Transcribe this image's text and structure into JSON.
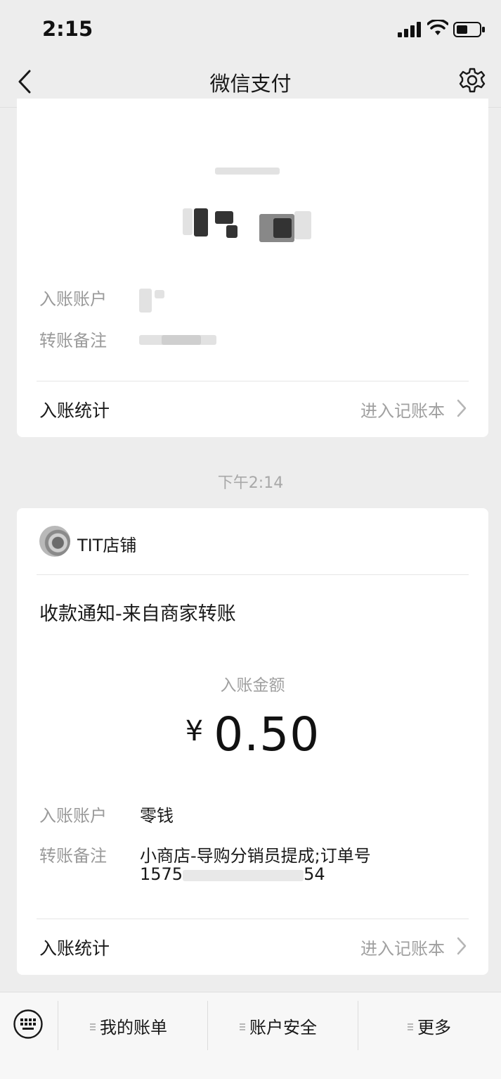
{
  "status_bar": {
    "time": "2:15",
    "icons": [
      "signal-icon",
      "wifi-icon",
      "battery-icon"
    ]
  },
  "nav": {
    "title": "微信支付",
    "back_icon": "chevron-left-icon",
    "settings_icon": "gear-icon"
  },
  "card1": {
    "account_label": "入账账户",
    "memo_label": "转账备注",
    "stats_label": "入账统计",
    "stats_link": "进入记账本"
  },
  "timestamp": "下午2:14",
  "card2": {
    "shop_name": "TIT店铺",
    "notice_title": "收款通知-来自商家转账",
    "amount_label": "入账金额",
    "currency": "¥",
    "amount": "0.50",
    "account_label": "入账账户",
    "account_value": "零钱",
    "memo_label": "转账备注",
    "memo_line1": "小商店-导购分销员提成;订单号",
    "memo_line2_start": "1575",
    "memo_line2_end": "54",
    "stats_label": "入账统计",
    "stats_link": "进入记账本"
  },
  "bottom_menu": {
    "keyboard_icon": "keyboard-icon",
    "items": [
      {
        "label": "我的账单"
      },
      {
        "label": "账户安全"
      },
      {
        "label": "更多"
      }
    ]
  },
  "colors": {
    "background": "#ededed",
    "card": "#ffffff",
    "secondary_text": "#9a9a9a"
  }
}
